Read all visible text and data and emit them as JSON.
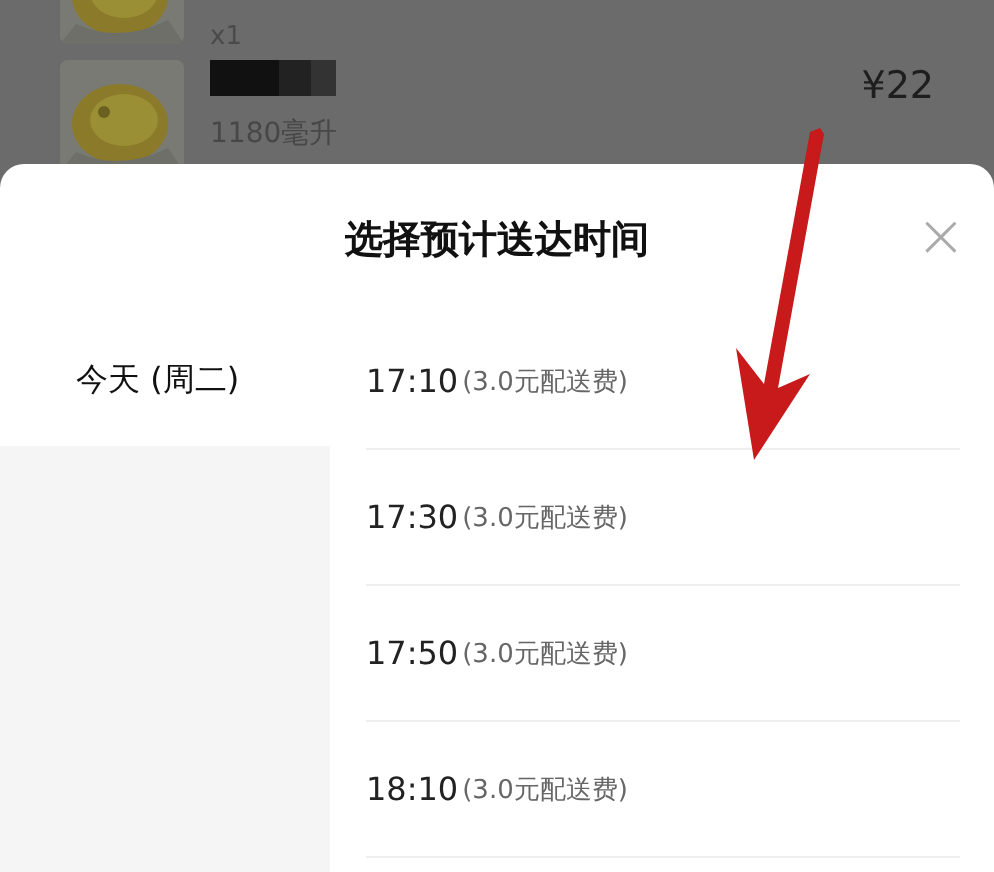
{
  "background_order": {
    "items": [
      {
        "kind": "picture",
        "quantity": "x1"
      },
      {
        "kind": "picture",
        "size": "1180毫升",
        "price": "¥22"
      }
    ]
  },
  "dialog": {
    "title": "选择预计送达时间",
    "close": "×",
    "days": [
      {
        "label": "今天 (周二)",
        "selected": true
      }
    ],
    "slots": [
      {
        "time": "17:10",
        "fee": "(3.0元配送费)"
      },
      {
        "time": "17:30",
        "fee": "(3.0元配送费)"
      },
      {
        "time": "17:50",
        "fee": "(3.0元配送费)"
      },
      {
        "time": "18:10",
        "fee": "(3.0元配送费)"
      }
    ]
  }
}
